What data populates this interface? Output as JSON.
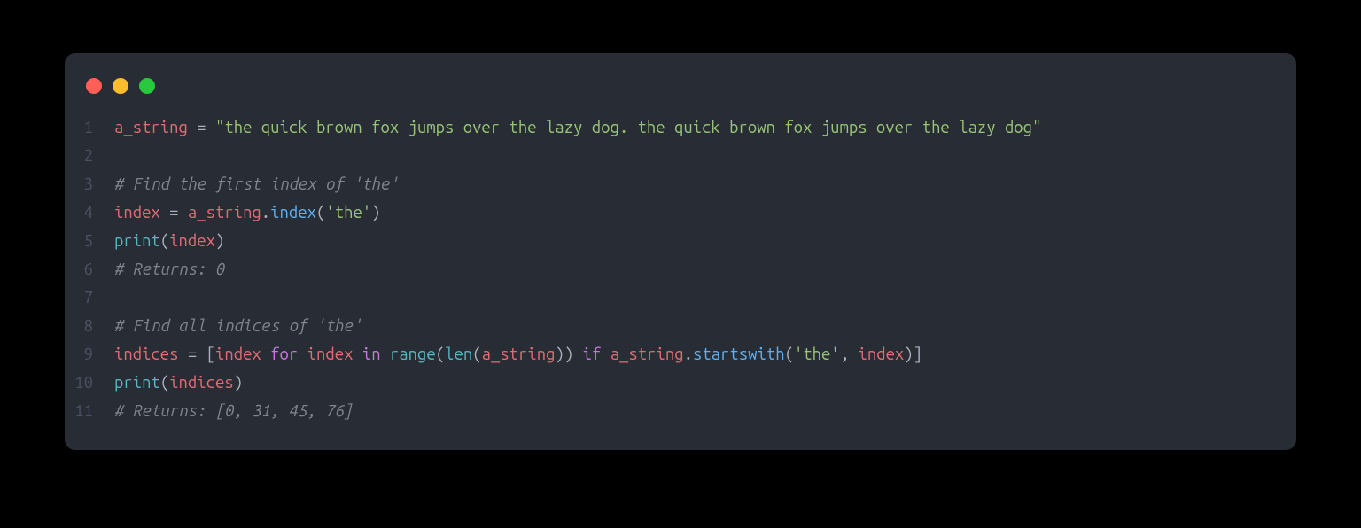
{
  "window": {
    "dots": [
      "red",
      "yellow",
      "green"
    ]
  },
  "code": {
    "lines": [
      {
        "n": "1",
        "tokens": [
          {
            "c": "tok-var",
            "t": "a_string"
          },
          {
            "c": "tok-op",
            "t": " = "
          },
          {
            "c": "tok-str",
            "t": "\"the quick brown fox jumps over the lazy dog. the quick brown fox jumps over the lazy dog\""
          }
        ]
      },
      {
        "n": "2",
        "tokens": []
      },
      {
        "n": "3",
        "tokens": [
          {
            "c": "tok-comment",
            "t": "# Find the first index of 'the'"
          }
        ]
      },
      {
        "n": "4",
        "tokens": [
          {
            "c": "tok-var",
            "t": "index"
          },
          {
            "c": "tok-op",
            "t": " = "
          },
          {
            "c": "tok-var",
            "t": "a_string"
          },
          {
            "c": "tok-op",
            "t": "."
          },
          {
            "c": "tok-func",
            "t": "index"
          },
          {
            "c": "tok-op",
            "t": "("
          },
          {
            "c": "tok-str",
            "t": "'the'"
          },
          {
            "c": "tok-op",
            "t": ")"
          }
        ]
      },
      {
        "n": "5",
        "tokens": [
          {
            "c": "tok-builtin",
            "t": "print"
          },
          {
            "c": "tok-op",
            "t": "("
          },
          {
            "c": "tok-var",
            "t": "index"
          },
          {
            "c": "tok-op",
            "t": ")"
          }
        ]
      },
      {
        "n": "6",
        "tokens": [
          {
            "c": "tok-comment",
            "t": "# Returns: 0"
          }
        ]
      },
      {
        "n": "7",
        "tokens": []
      },
      {
        "n": "8",
        "tokens": [
          {
            "c": "tok-comment",
            "t": "# Find all indices of 'the'"
          }
        ]
      },
      {
        "n": "9",
        "tokens": [
          {
            "c": "tok-var",
            "t": "indices"
          },
          {
            "c": "tok-op",
            "t": " = ["
          },
          {
            "c": "tok-var",
            "t": "index"
          },
          {
            "c": "tok-plain",
            "t": " "
          },
          {
            "c": "tok-kw",
            "t": "for"
          },
          {
            "c": "tok-plain",
            "t": " "
          },
          {
            "c": "tok-var",
            "t": "index"
          },
          {
            "c": "tok-plain",
            "t": " "
          },
          {
            "c": "tok-kw",
            "t": "in"
          },
          {
            "c": "tok-plain",
            "t": " "
          },
          {
            "c": "tok-builtin",
            "t": "range"
          },
          {
            "c": "tok-op",
            "t": "("
          },
          {
            "c": "tok-builtin",
            "t": "len"
          },
          {
            "c": "tok-op",
            "t": "("
          },
          {
            "c": "tok-var",
            "t": "a_string"
          },
          {
            "c": "tok-op",
            "t": ")) "
          },
          {
            "c": "tok-kw",
            "t": "if"
          },
          {
            "c": "tok-plain",
            "t": " "
          },
          {
            "c": "tok-var",
            "t": "a_string"
          },
          {
            "c": "tok-op",
            "t": "."
          },
          {
            "c": "tok-func",
            "t": "startswith"
          },
          {
            "c": "tok-op",
            "t": "("
          },
          {
            "c": "tok-str",
            "t": "'the'"
          },
          {
            "c": "tok-op",
            "t": ", "
          },
          {
            "c": "tok-var",
            "t": "index"
          },
          {
            "c": "tok-op",
            "t": ")]"
          }
        ]
      },
      {
        "n": "10",
        "tokens": [
          {
            "c": "tok-builtin",
            "t": "print"
          },
          {
            "c": "tok-op",
            "t": "("
          },
          {
            "c": "tok-var",
            "t": "indices"
          },
          {
            "c": "tok-op",
            "t": ")"
          }
        ]
      },
      {
        "n": "11",
        "tokens": [
          {
            "c": "tok-comment",
            "t": "# Returns: [0, 31, 45, 76]"
          }
        ]
      }
    ]
  }
}
